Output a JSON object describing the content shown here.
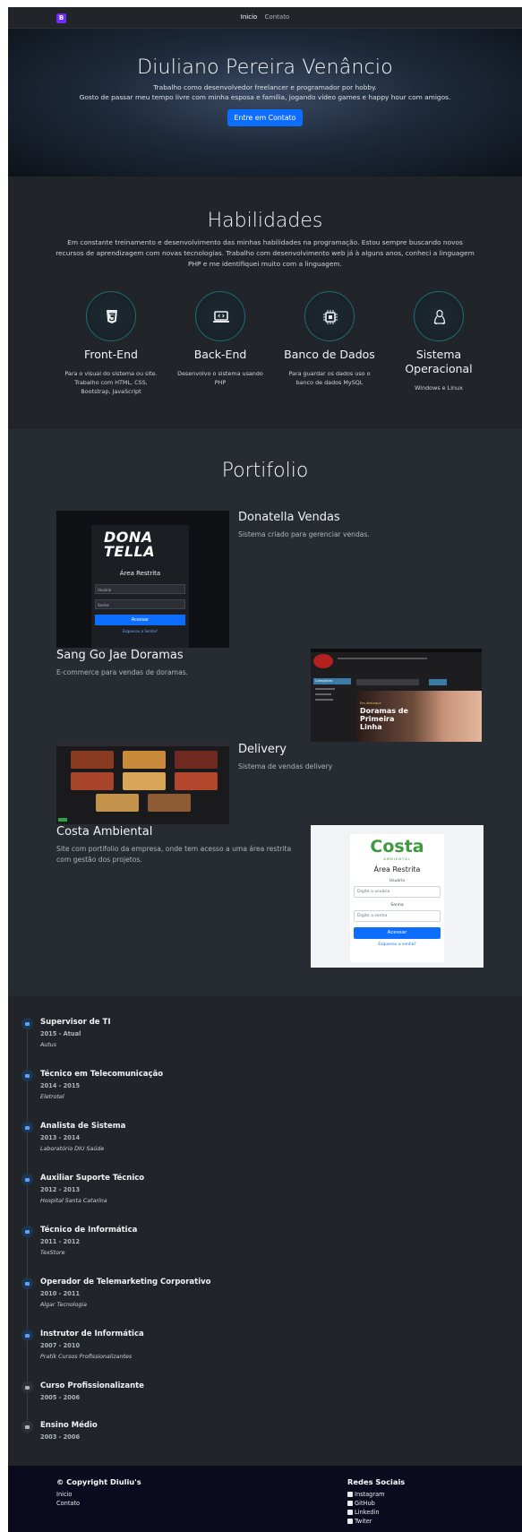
{
  "nav": {
    "brand": "B",
    "links": [
      "Inicio",
      "Contato"
    ]
  },
  "hero": {
    "title": "Diuliano Pereira Venâncio",
    "line1": "Trabalho como desenvolvedor freelancer e programador por hobby.",
    "line2": "Gosto de passar meu tempo livre com minha esposa e família, jogando vídeo games e happy hour com amigos.",
    "button": "Entre em Contato"
  },
  "skills": {
    "title": "Habilidades",
    "intro": "Em constante treinamento e desenvolvimento das minhas habilidades na programação. Estou sempre buscando novos recursos de aprendizagem com novas tecnologias. Trabalho com desenvolvimento web já à alguns anos, conheci a linguagem PHP e me identifiquei muito com a linguagem.",
    "items": [
      {
        "icon": "css3-icon",
        "title": "Front-End",
        "desc": "Para o visual do sistema ou site. Trabalho com HTML, CSS, Bootstrap, JavaScript"
      },
      {
        "icon": "laptop-code-icon",
        "title": "Back-End",
        "desc": "Desenvolvo o sistema usando PHP"
      },
      {
        "icon": "cpu-icon",
        "title": "Banco de Dados",
        "desc": "Para guardar os dados uso o banco de dados MySQL"
      },
      {
        "icon": "linux-icon",
        "title": "Sistema Operacional",
        "desc": "Windows e Linux"
      }
    ]
  },
  "portfolio": {
    "title": "Portifolio",
    "projects": [
      {
        "title": "Donatella Vendas",
        "desc": "Sistema criado para gerenciar vendas.",
        "thumb": {
          "logo": "DONA TELLA",
          "heading": "Área Restrita",
          "user": "Usuário",
          "pass": "Senha",
          "button": "Acessar",
          "forgot": "Esqueceu a Senha?"
        }
      },
      {
        "title": "Sang Go Jae Doramas",
        "desc": "E-commerce para vendas de doramas.",
        "thumb": {
          "banner_small": "Em destaque",
          "banner": "Doramas de Primeira Linha",
          "menu": "Categorias"
        }
      },
      {
        "title": "Delivery",
        "desc": "Sistema de vendas delivery"
      },
      {
        "title": "Costa Ambiental",
        "desc": "Site com portifolio da empresa, onde tem acesso a uma área restrita com gestão dos projetos.",
        "thumb": {
          "logo": "Costa",
          "logo_sub": "AMBIENTAL",
          "heading": "Área Restrita",
          "user_label": "Usuário",
          "user_ph": "Digite o usuário",
          "pass_label": "Senha",
          "pass_ph": "Digite a senha",
          "button": "Acessar",
          "forgot": "Esqueceu a senha?"
        }
      }
    ]
  },
  "timeline": [
    {
      "title": "Supervisor de TI",
      "date": "2015 - Atual",
      "place": "Autus",
      "icon": "briefcase-icon"
    },
    {
      "title": "Técnico em Telecomunicação",
      "date": "2014 - 2015",
      "place": "Eletrotel",
      "icon": "briefcase-icon"
    },
    {
      "title": "Analista de Sistema",
      "date": "2013 - 2014",
      "place": "Laboratório DIU Saúde",
      "icon": "briefcase-icon"
    },
    {
      "title": "Auxiliar Suporte Técnico",
      "date": "2012 - 2013",
      "place": "Hospital Santa Catarina",
      "icon": "briefcase-icon"
    },
    {
      "title": "Técnico de Informática",
      "date": "2011 - 2012",
      "place": "TexStore",
      "icon": "briefcase-icon"
    },
    {
      "title": "Operador de Telemarketing Corporativo",
      "date": "2010 - 2011",
      "place": "Algar Tecnologia",
      "icon": "briefcase-icon"
    },
    {
      "title": "Instrutor de Informática",
      "date": "2007 - 2010",
      "place": "Pratik Cursos Profissionalizantes",
      "icon": "briefcase-icon"
    },
    {
      "title": "Curso Profissionalizante",
      "date": "2005 - 2006",
      "place": "",
      "icon": "graduation-cap-icon"
    },
    {
      "title": "Ensino Médio",
      "date": "2003 - 2006",
      "place": "",
      "icon": "school-icon"
    }
  ],
  "footer": {
    "copyright": "© Copyright Diuliu's",
    "links": [
      "Inicio",
      "Contato"
    ],
    "social_title": "Redes Sociais",
    "social": [
      "Instagram",
      "GitHub",
      "Linkedin",
      "Twiter"
    ]
  }
}
